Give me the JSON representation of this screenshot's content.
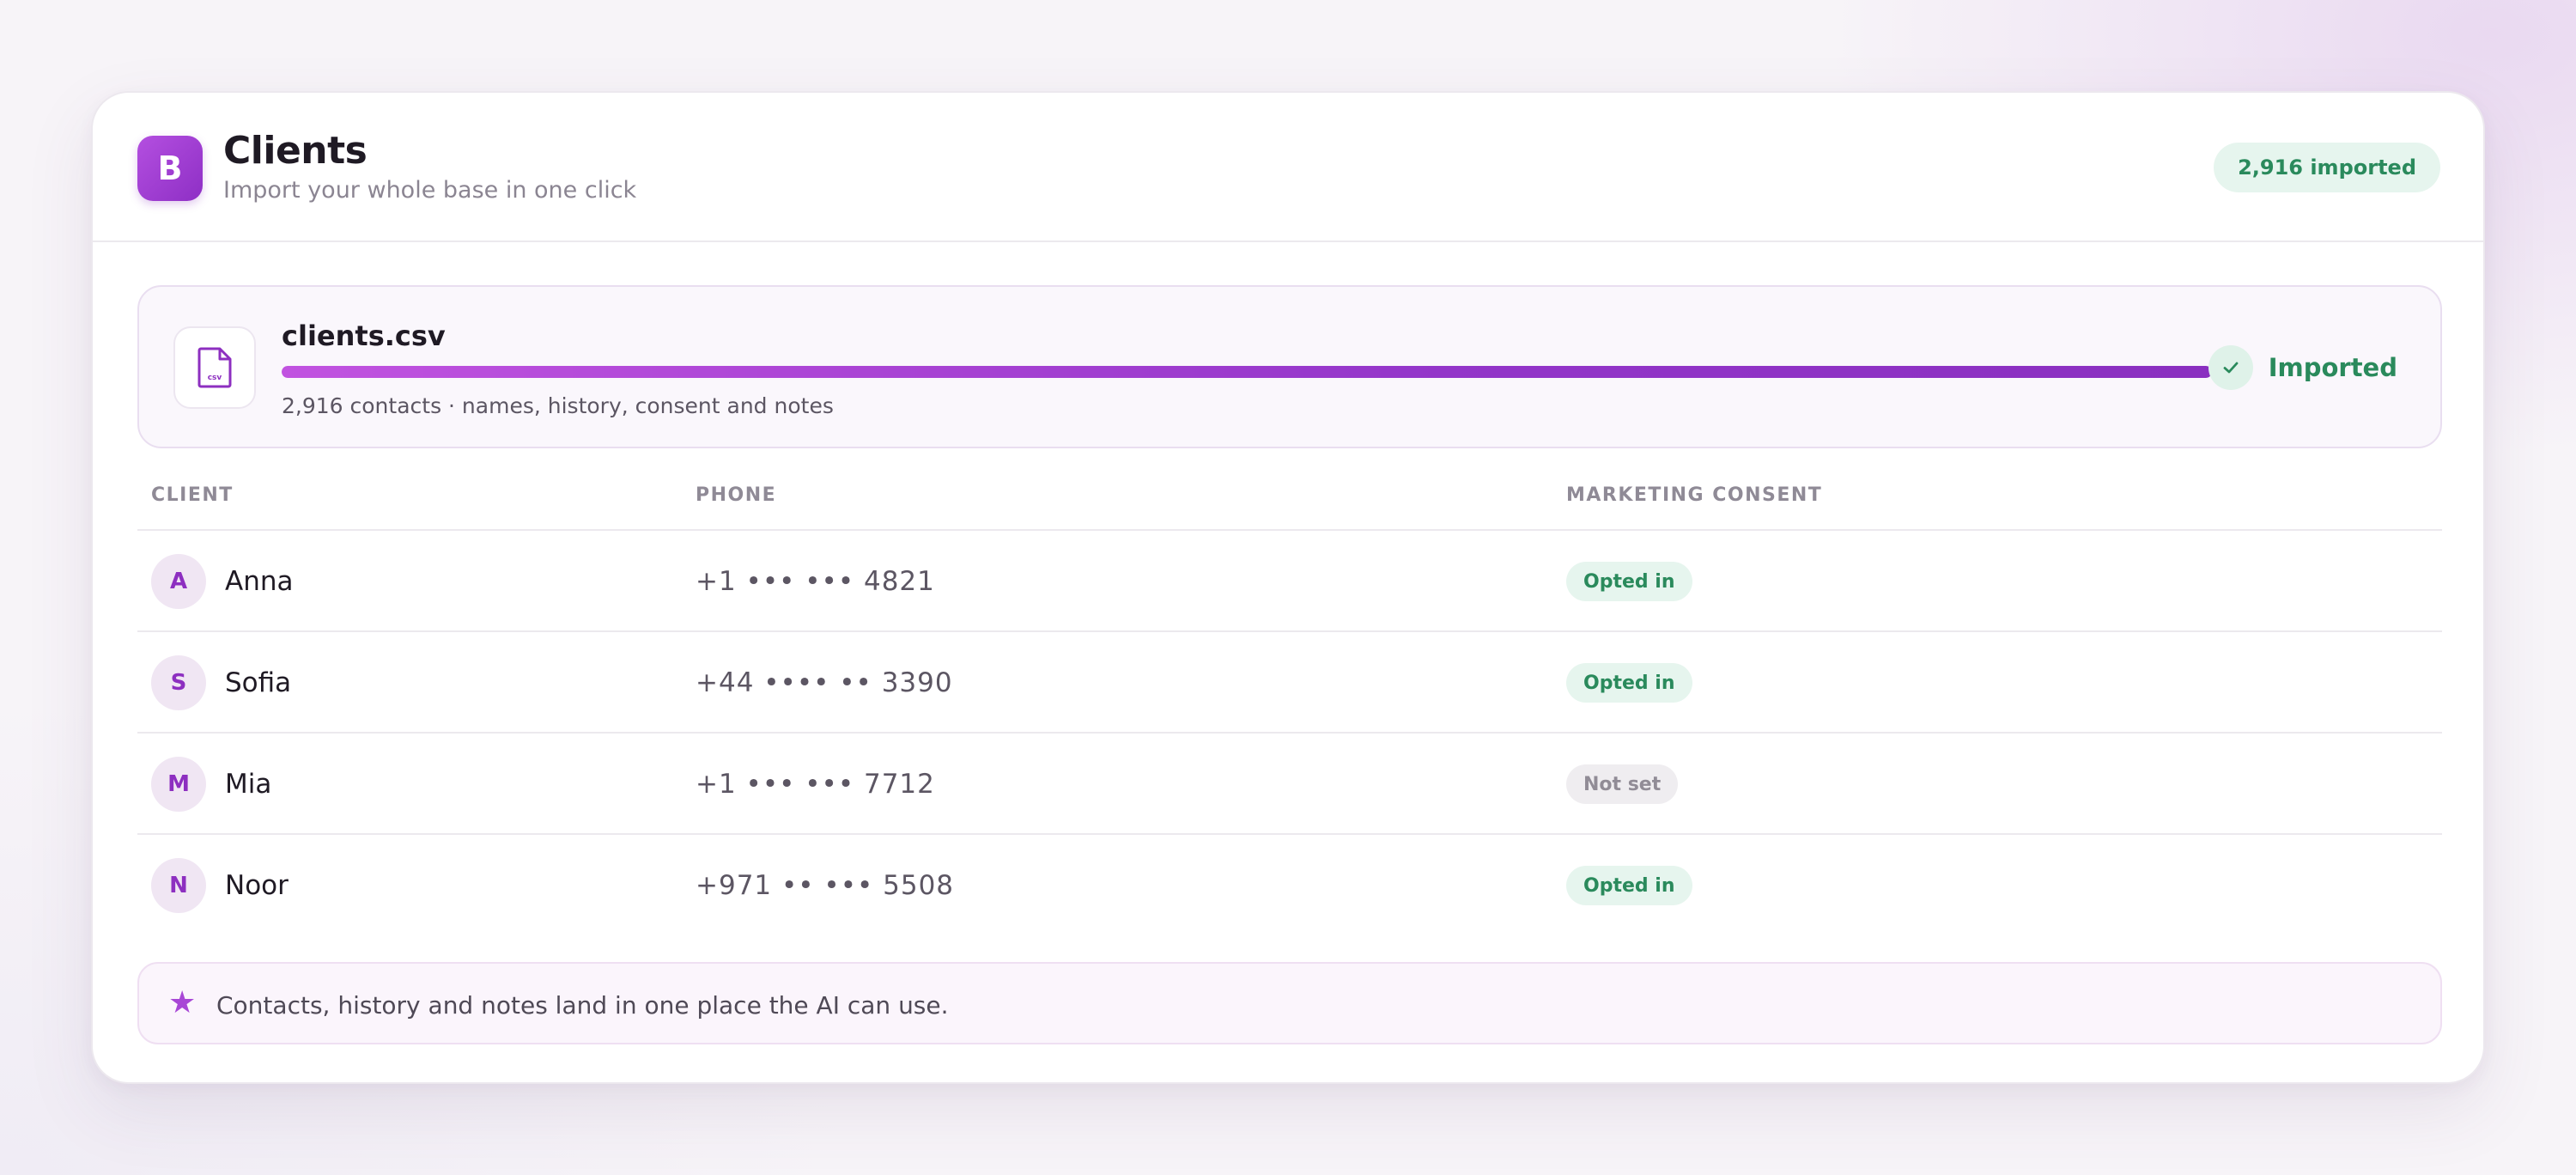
{
  "header": {
    "logo_letter": "B",
    "title": "Clients",
    "subtitle": "Import your whole base in one click",
    "imported_badge": "2,916 imported"
  },
  "file": {
    "icon": "csv-file-icon",
    "icon_label": "csv",
    "name": "clients.csv",
    "progress": 1.0,
    "meta": "2,916 contacts · names, history, consent and notes",
    "status": "Imported",
    "status_icon": "check-icon"
  },
  "table": {
    "columns": [
      "CLIENT",
      "PHONE",
      "MARKETING CONSENT"
    ],
    "rows": [
      {
        "initial": "A",
        "name": "Anna",
        "phone": "+1 ••• ••• 4821",
        "consent": "Opted in"
      },
      {
        "initial": "S",
        "name": "Sofia",
        "phone": "+44 •••• •• 3390",
        "consent": "Opted in"
      },
      {
        "initial": "M",
        "name": "Mia",
        "phone": "+1 ••• ••• 7712",
        "consent": "Not set"
      },
      {
        "initial": "N",
        "name": "Noor",
        "phone": "+971 •• ••• 5508",
        "consent": "Opted in"
      }
    ]
  },
  "note": {
    "icon": "star-icon",
    "text": "Contacts, history and notes land in one place the AI can use."
  },
  "colors": {
    "accent": "#9b3fd0",
    "success": "#2a8a5c",
    "success_bg": "#e6f5ee",
    "neutral_bg": "#efedf0"
  }
}
